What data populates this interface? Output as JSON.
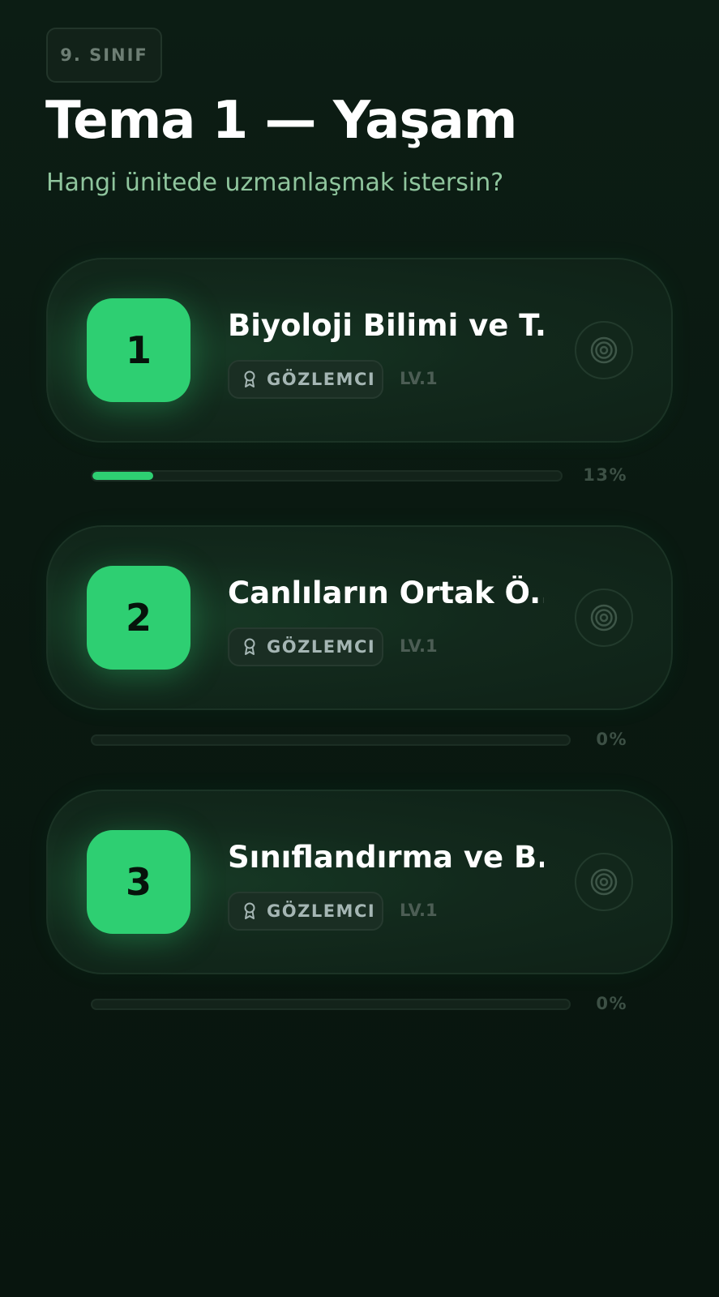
{
  "header": {
    "grade": "9. SINIF",
    "title": "Tema 1 — Yaşam",
    "subtitle": "Hangi ünitede uzmanlaşmak istersin?"
  },
  "units": [
    {
      "number": "1",
      "title": "Biyoloji Bilimi ve T...",
      "rank": "GÖZLEMCI",
      "rank_icon": "award-ribbon-icon",
      "level": "LV.1",
      "action_icon": "target-icon",
      "progress": 0.13,
      "progress_label": "13%"
    },
    {
      "number": "2",
      "title": "Canlıların Ortak Ö...",
      "rank": "GÖZLEMCI",
      "rank_icon": "award-ribbon-icon",
      "level": "LV.1",
      "action_icon": "target-icon",
      "progress": 0,
      "progress_label": "0%"
    },
    {
      "number": "3",
      "title": "Sınıflandırma ve B...",
      "rank": "GÖZLEMCI",
      "rank_icon": "award-ribbon-icon",
      "level": "LV.1",
      "action_icon": "target-icon",
      "progress": 0,
      "progress_label": "0%"
    }
  ],
  "colors": {
    "background": "#0a1a12",
    "accent": "#2ecf72",
    "subtitle": "#8fc59d"
  }
}
